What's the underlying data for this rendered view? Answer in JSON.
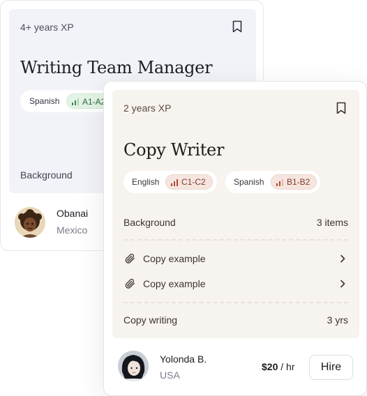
{
  "back_card": {
    "experience": "4+ years XP",
    "title": "Writing Team Manager",
    "languages": [
      {
        "name": "Spanish",
        "level": "A1-A2"
      }
    ],
    "background_label": "Background",
    "person": {
      "name": "Obanai",
      "country": "Mexico"
    }
  },
  "front_card": {
    "experience": "2 years XP",
    "title": "Copy Writer",
    "languages": [
      {
        "name": "English",
        "level": "C1-C2"
      },
      {
        "name": "Spanish",
        "level": "B1-B2"
      }
    ],
    "background": {
      "label": "Background",
      "value": "3 items"
    },
    "attachments": [
      {
        "label": "Copy example"
      },
      {
        "label": "Copy example"
      }
    ],
    "skill": {
      "label": "Copy writing",
      "value": "3 yrs"
    },
    "person": {
      "name": "Yolonda B.",
      "country": "USA"
    },
    "rate": {
      "amount": "$20",
      "unit": " / hr"
    },
    "hire_label": "Hire"
  },
  "icons": [
    "bookmark-icon",
    "signal-bars-icon",
    "paperclip-icon",
    "chevron-right-icon"
  ],
  "colors": {
    "back_panel": "#f2f3f8",
    "front_panel": "#f7f3ee",
    "green_badge": "#e3f3e6",
    "red_badge": "#f6e5df"
  }
}
